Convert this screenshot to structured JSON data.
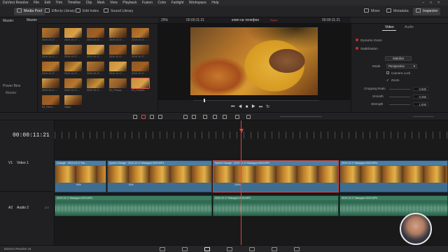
{
  "titlebar": {
    "menu": [
      "DaVinci Resolve",
      "File",
      "Edit",
      "Trim",
      "Timeline",
      "Clip",
      "Mark",
      "View",
      "Playback",
      "Fusion",
      "Color",
      "Fairlight",
      "Workspace",
      "Help"
    ],
    "project_title": "клип на телефон"
  },
  "toolbar": {
    "media_pool": "Media Pool",
    "effects_library": "Effects Library",
    "edit_index": "Edit Index",
    "sound_library": "Sound Library",
    "mixer": "Mixer",
    "metadata": "Metadata",
    "inspector": "Inspector"
  },
  "media_pool": {
    "bin_header": "Master",
    "master": "Master",
    "power_bins": "Power Bins",
    "power_master": "Master",
    "thumb_captions": [
      "2019 10 17 ...",
      "2019 10 17 ...",
      "2019 10 17 ...",
      "2019 10 17 ...",
      "2019 10 17 ...",
      "2019 10 17 ...",
      "2019 10 17 ...",
      "2019 10 17 ...",
      "2019 10 17 ...",
      "2019 10 17 ...",
      "2019 10 17 ...",
      "2019 10 17 ...",
      "2019 10 17 ...",
      "2019 10 17 ...",
      "2019 10 17 ...",
      "2019 10 17 ...",
      "2019 10 17 ...",
      "2019 10 17 ...",
      "E1_Prinop...",
      "E3_Ponem...",
      "E5_Rech ...",
      "Video"
    ]
  },
  "viewer": {
    "zoom": "29%",
    "timecode": "00:00:11:21",
    "clip_name": "клип на телефон",
    "status_label": "Звуки"
  },
  "inspector": {
    "tab_video": "Video",
    "tab_audio": "Audio",
    "dynamic_zoom": "Dynamic Zoom",
    "stabilization": "Stabilization",
    "stabilize_button": "Stabilize",
    "mode_label": "Mode",
    "mode_value": "Perspective",
    "camera_lock": "Camera Lock",
    "zoom": "Zoom",
    "cropping_ratio_label": "Cropping Ratio",
    "cropping_ratio_value": "0.500",
    "smooth_label": "Smooth",
    "smooth_value": "0.250",
    "strength_label": "Strength",
    "strength_value": "1.000"
  },
  "timeline": {
    "timecode": "00:00:11:21",
    "v1_code": "V1",
    "v1_name": "Video 1",
    "a2_code": "A2",
    "a2_name": "Audio 2",
    "a2_level": "2.0",
    "clips_video": [
      {
        "name": "Change · 2019 10 17 Ма...",
        "speed": "64%"
      },
      {
        "name": "Speed Change · 2019 10 17 Македон 0023.MP4",
        "speed": "64%"
      },
      {
        "name": "Speed Change · 2019 10 17 Македон 0034.MP4",
        "speed": "100%"
      },
      {
        "name": "2019 10 17 Македон 0023.MP4",
        "speed": ""
      }
    ],
    "clips_audio": [
      {
        "name": "2019 10 17 Македон 0023.MP4"
      },
      {
        "name": "2019 10 17 Македон 0034.MP4"
      },
      {
        "name": "2019 10 17 Македон 0023.MP4"
      }
    ]
  },
  "pagebar": {
    "app_label": "DaVinci Resolve 16"
  }
}
